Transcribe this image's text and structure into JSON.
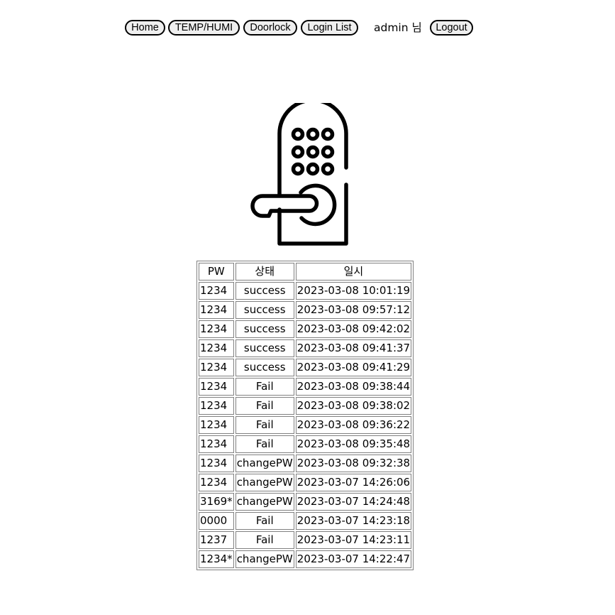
{
  "nav": {
    "home_label": "Home",
    "temp_humi_label": "TEMP/HUMI",
    "doorlock_label": "Doorlock",
    "login_list_label": "Login List",
    "user_text": "admin  님",
    "logout_label": "Logout"
  },
  "hero": {
    "icon": "door-lock-icon"
  },
  "log_table": {
    "headers": [
      "PW",
      "상태",
      "일시"
    ],
    "rows": [
      [
        "1234",
        "success",
        "2023-03-08 10:01:19"
      ],
      [
        "1234",
        "success",
        "2023-03-08 09:57:12"
      ],
      [
        "1234",
        "success",
        "2023-03-08 09:42:02"
      ],
      [
        "1234",
        "success",
        "2023-03-08 09:41:37"
      ],
      [
        "1234",
        "success",
        "2023-03-08 09:41:29"
      ],
      [
        "1234",
        "Fail",
        "2023-03-08 09:38:44"
      ],
      [
        "1234",
        "Fail",
        "2023-03-08 09:38:02"
      ],
      [
        "1234",
        "Fail",
        "2023-03-08 09:36:22"
      ],
      [
        "1234",
        "Fail",
        "2023-03-08 09:35:48"
      ],
      [
        "1234",
        "changePW",
        "2023-03-08 09:32:38"
      ],
      [
        "1234",
        "changePW",
        "2023-03-07 14:26:06"
      ],
      [
        "3169*",
        "changePW",
        "2023-03-07 14:24:48"
      ],
      [
        "0000",
        "Fail",
        "2023-03-07 14:23:18"
      ],
      [
        "1237",
        "Fail",
        "2023-03-07 14:23:11"
      ],
      [
        "1234*",
        "changePW",
        "2023-03-07 14:22:47"
      ]
    ]
  }
}
